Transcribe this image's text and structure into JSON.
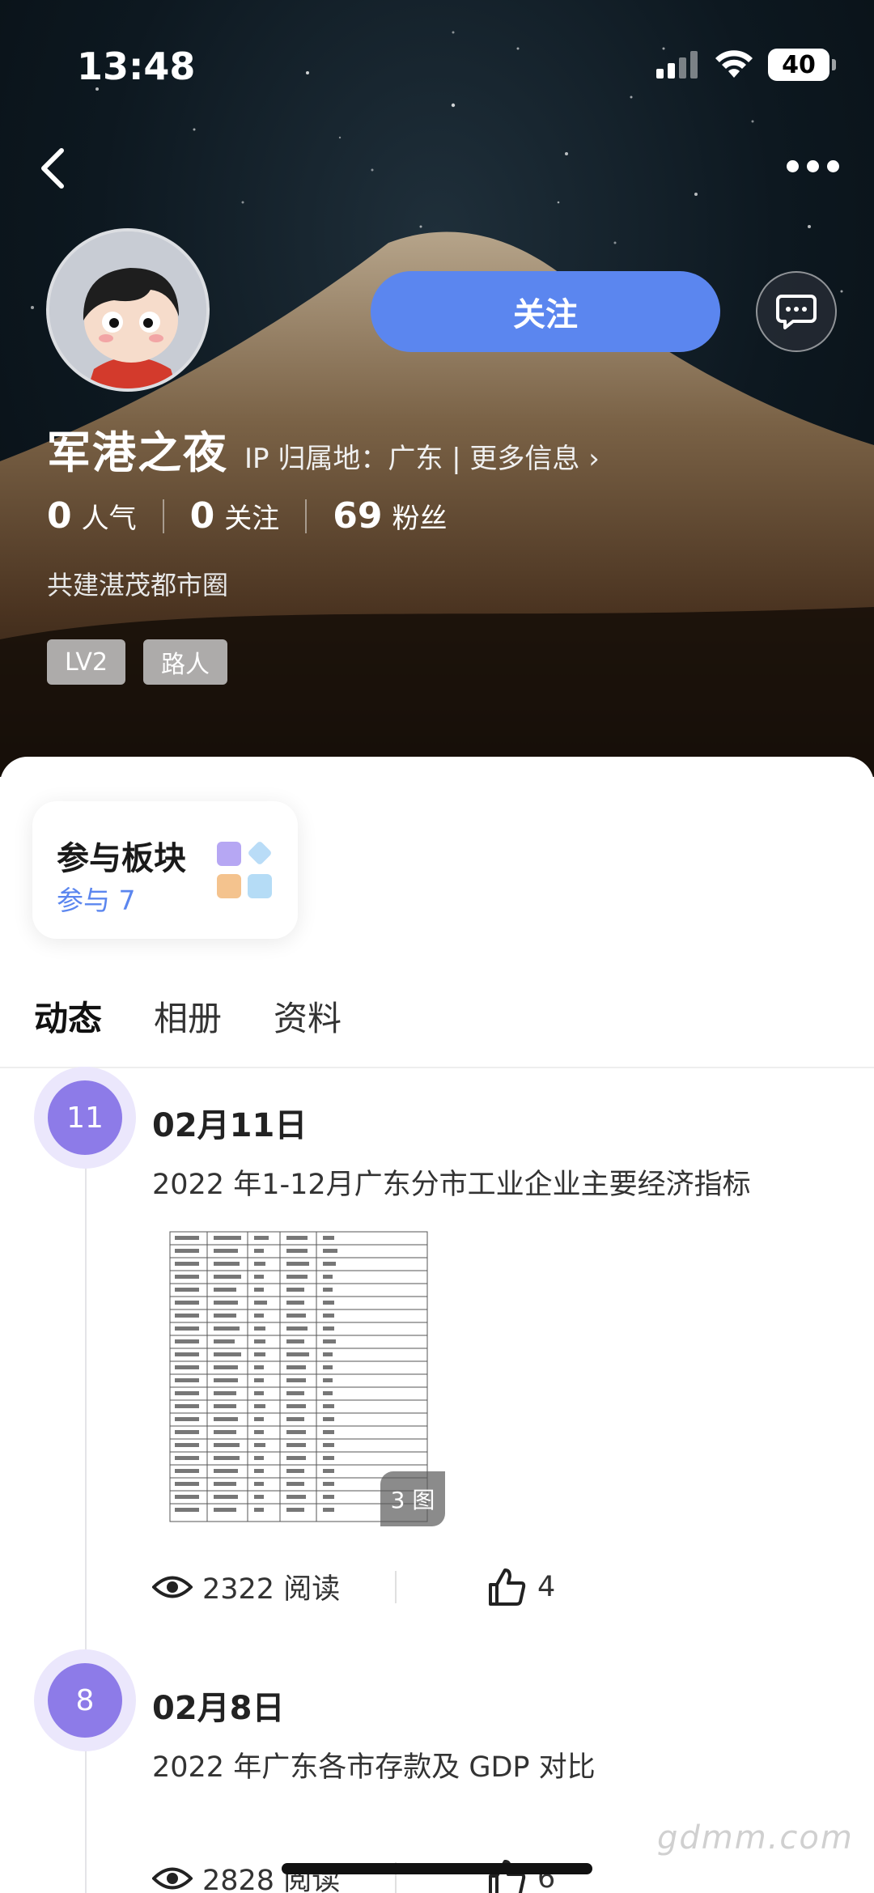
{
  "status_bar": {
    "time": "13:48",
    "battery": "40"
  },
  "profile": {
    "name": "军港之夜",
    "ip_location": "IP 归属地：广东",
    "more_info": "| 更多信息",
    "bio": "共建湛茂都市圈",
    "tags": [
      "LV2",
      "路人"
    ],
    "follow_label": "关注",
    "stats": [
      {
        "value": "0",
        "label": "人气"
      },
      {
        "value": "0",
        "label": "关注"
      },
      {
        "value": "69",
        "label": "粉丝"
      }
    ]
  },
  "board": {
    "title": "参与板块",
    "count": "参与 7"
  },
  "tabs": [
    "动态",
    "相册",
    "资料"
  ],
  "posts": [
    {
      "day": "11",
      "date": "02月11日",
      "title": "2022 年1-12月广东分市工业企业主要经济指标",
      "image_count": "3 图",
      "views": "2322 阅读",
      "likes": "4"
    },
    {
      "day": "8",
      "date": "02月8日",
      "title": "2022 年广东各市存款及 GDP 对比",
      "views": "2828 阅读",
      "likes": "6"
    }
  ],
  "watermark": "gdmm.com",
  "colors": {
    "accent": "#5b86ef",
    "badge": "#8d7be8"
  },
  "icons": [
    "back-icon",
    "more-icon",
    "message-icon",
    "eye-icon",
    "thumb-up-icon",
    "signal-icon",
    "wifi-icon",
    "battery-icon"
  ]
}
